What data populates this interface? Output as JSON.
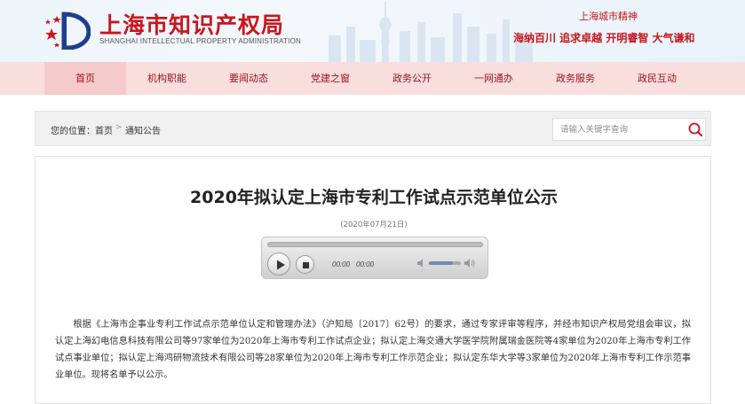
{
  "header": {
    "site_title": "上海市知识产权局",
    "site_subtitle": "SHANGHAI INTELLECTUAL PROPERTY ADMINISTRATION",
    "spirit_title": "上海城市精神",
    "spirit_text": "海纳百川 追求卓越 开明睿智 大气谦和",
    "brand_color": "#c8161d",
    "logo_icon": "shanghai-ip-logo-icon"
  },
  "nav": {
    "items": [
      {
        "label": "首页",
        "active": true
      },
      {
        "label": "机构职能"
      },
      {
        "label": "要闻动态"
      },
      {
        "label": "党建之窗"
      },
      {
        "label": "政务公开"
      },
      {
        "label": "一网通办"
      },
      {
        "label": "政务服务"
      },
      {
        "label": "政民互动"
      }
    ]
  },
  "breadcrumb": {
    "prefix": "您的位置：",
    "items": [
      "首页",
      "通知公告"
    ],
    "separator": ">"
  },
  "search": {
    "placeholder": "请输入关键字查询",
    "value": "",
    "icon": "search-icon"
  },
  "article": {
    "title": "2020年拟认定上海市专利工作试点示范单位公示",
    "date": "(2020年07月21日)",
    "body": "根据《上海市企事业专利工作试点示范单位认定和管理办法》（沪知局〔2017〕62号）的要求，通过专家评审等程序，并经市知识产权局党组会审议，拟认定上海幻电信息科技有限公司等97家单位为2020年上海市专利工作试点企业；拟认定上海交通大学医学院附属瑞金医院等4家单位为2020年上海市专利工作试点事业单位；拟认定上海鸿研物流技术有限公司等28家单位为2020年上海市专利工作示范企业；拟认定东华大学等3家单位为2020年上海市专利工作示范事业单位。现将名单予以公示。"
  },
  "player": {
    "current_time": "00:00",
    "duration": "00:00",
    "volume": 0.75,
    "progress": 0
  }
}
